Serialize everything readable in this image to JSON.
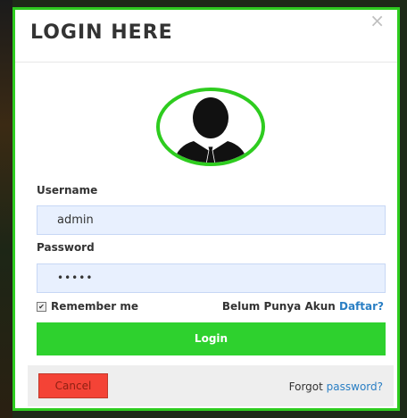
{
  "modal": {
    "title": "LOGIN HERE",
    "close_symbol": "×"
  },
  "avatar": {
    "icon": "user-avatar-icon",
    "ring_color": "#2ecc1f"
  },
  "form": {
    "username_label": "Username",
    "username_value": "admin",
    "password_label": "Password",
    "password_value": "•••••",
    "remember_label": "Remember me",
    "remember_checked": true,
    "signup_text": "Belum Punya Akun",
    "signup_link": "Daftar?",
    "login_label": "Login"
  },
  "footer": {
    "cancel_label": "Cancel",
    "forgot_prefix": "Forgot",
    "forgot_link": "password?"
  },
  "colors": {
    "accent_green": "#2ed12e",
    "cancel_red": "#f44336",
    "link_blue": "#2a7fc4",
    "input_bg": "#e8f0fe"
  }
}
